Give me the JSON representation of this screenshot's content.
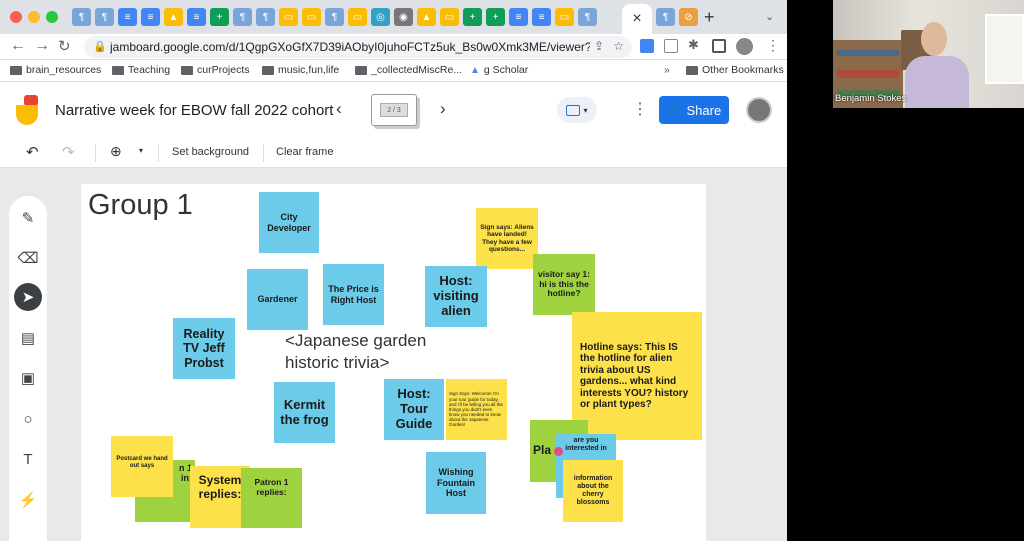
{
  "browser": {
    "url": "jamboard.google.com/d/1QgpGXoGfX7D39iAObyI0juhoFCTz5uk_Bs0w0Xmk3ME/viewer?...",
    "bookmarks": [
      "brain_resources",
      "Teaching",
      "curProjects",
      "music,fun,life",
      "_collectedMiscRe...",
      "g Scholar",
      "Other Bookmarks"
    ],
    "tab_close": "×",
    "new_tab": "+",
    "more": "»"
  },
  "jamboard": {
    "title": "Narrative week for EBOW fall 2022 cohort",
    "frame_indicator": "2 / 3",
    "share_label": "Share",
    "toolbar": {
      "set_background": "Set background",
      "clear_frame": "Clear frame"
    },
    "frame_title": "Group 1",
    "center_text": "<Japanese garden historic trivia>",
    "notes": {
      "city_developer": "City Developer",
      "sign_aliens": "Sign says: Aliens have landed! They have a few questions...",
      "gardener": "Gardener",
      "price_right": "The Price is Right Host",
      "host_alien": "Host: visiting alien",
      "visitor": "visitor say 1: hi is this the hotline?",
      "reality_tv": "Reality TV Jeff Probst",
      "hotline": "Hotline says: This IS the hotline for alien trivia about US gardens... what kind interests YOU? history or plant types?",
      "kermit": "Kermit the frog",
      "host_tour": "Host: Tour Guide",
      "sign_welcome": "Sign Says: Welcome! I'm your tour guide for today, and I'll be telling you all the things you didn't even know you needed to know about the Japanese Garden!",
      "pla": "Pla",
      "are_you": "are you interested in",
      "postcard": "Postcard we hand out says",
      "patron_partial_1": "n 1",
      "patron_partial_2": "in:",
      "system_replies": "System replies:",
      "patron1_replies": "Patron 1 replies:",
      "wishing_fountain": "Wishing Fountain Host",
      "cherry": "information about the cherry blossoms"
    }
  },
  "webcam": {
    "name": "Benjamin Stokes"
  }
}
